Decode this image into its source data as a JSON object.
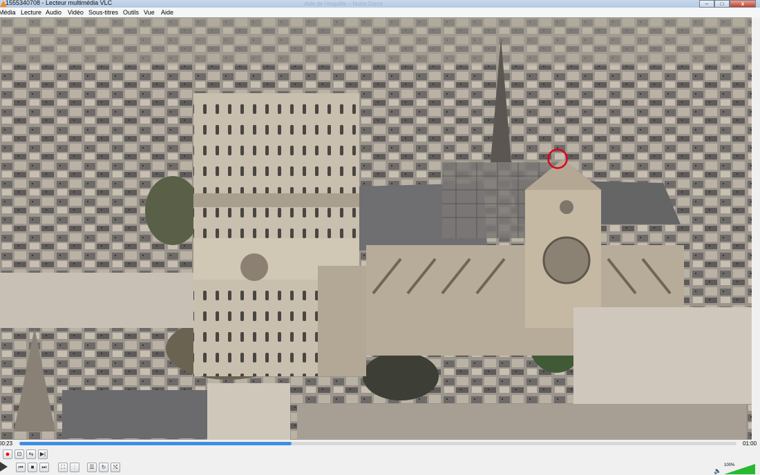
{
  "window": {
    "title": "1555340708 - Lecteur multimédia VLC",
    "ghost_text": "Aide de l'enquête – Notre-Dame",
    "minimize": "–",
    "maximize": "□",
    "close": "x"
  },
  "menu": [
    "Média",
    "Lecture",
    "Audio",
    "Vidéo",
    "Sous-titres",
    "Outils",
    "Vue",
    "Aide"
  ],
  "playback": {
    "elapsed": "00:23",
    "total": "01:00",
    "progress": 0.38
  },
  "volume": {
    "label": "100%",
    "level": 1.0
  },
  "colors": {
    "progress": "#3f8ee3",
    "volume": "#29b82f",
    "record": "#e00000",
    "annotation_circle": "#e0001b"
  },
  "icons": {
    "record": "●",
    "snapshot": "⊡",
    "loop_ab": "⇆",
    "frame": "▶|",
    "prev": "⏮",
    "stop": "■",
    "next": "⏭",
    "fullscreen": "⛶",
    "extended": "⫶",
    "playlist": "☰",
    "loop": "↻",
    "shuffle": "⤭",
    "speaker": "🔈"
  }
}
